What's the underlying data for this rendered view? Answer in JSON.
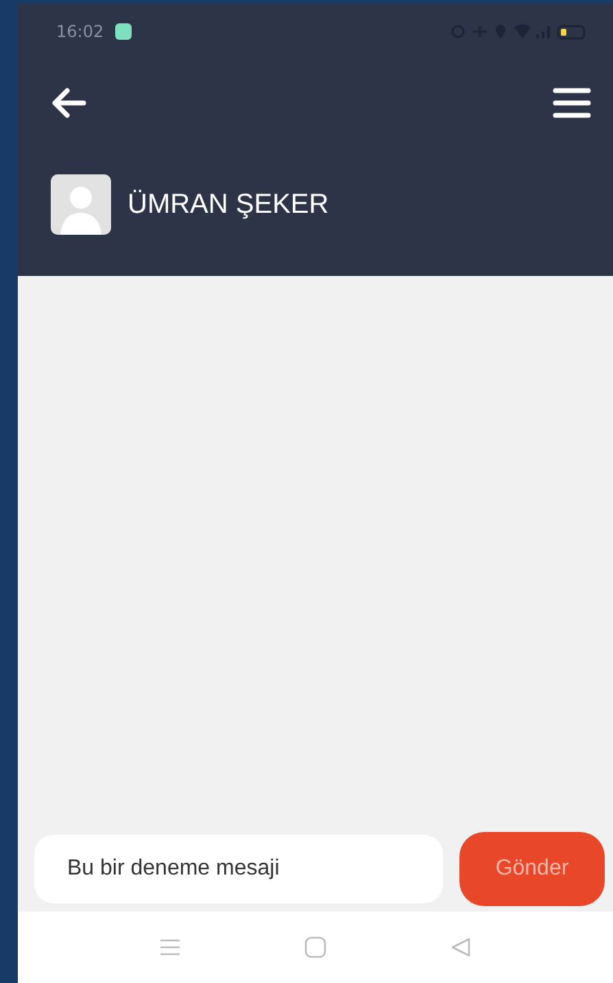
{
  "status_bar": {
    "time": "16:02"
  },
  "header": {
    "contact_name": "ÜMRAN ŞEKER"
  },
  "composer": {
    "value": "Bu bir deneme mesaji",
    "send_label": "Gönder"
  }
}
